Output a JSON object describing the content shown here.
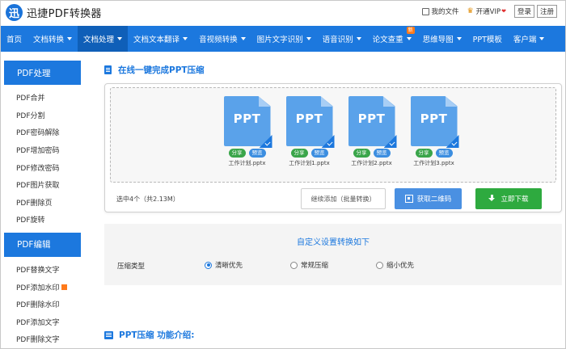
{
  "app": {
    "logo_mark": "迅",
    "logo_text": "迅捷PDF转换器"
  },
  "top_links": {
    "my_files": "我的文件",
    "open_vip": "开通VIP",
    "vip_badge": "❤",
    "login": "登录",
    "register": "注册"
  },
  "nav": [
    {
      "label": "首页",
      "dropdown": false,
      "active": false
    },
    {
      "label": "文档转换",
      "dropdown": true,
      "active": false
    },
    {
      "label": "文档处理",
      "dropdown": true,
      "active": true
    },
    {
      "label": "文档文本翻译",
      "dropdown": true,
      "active": false
    },
    {
      "label": "音视频转换",
      "dropdown": true,
      "active": false
    },
    {
      "label": "图片文字识别",
      "dropdown": true,
      "active": false
    },
    {
      "label": "语音识别",
      "dropdown": true,
      "active": false
    },
    {
      "label": "论文查重",
      "dropdown": true,
      "active": false,
      "badge": "新"
    },
    {
      "label": "思维导图",
      "dropdown": true,
      "active": false
    },
    {
      "label": "PPT模板",
      "dropdown": false,
      "active": false
    },
    {
      "label": "客户端",
      "dropdown": true,
      "active": false
    }
  ],
  "sidebar": {
    "group1_title": "PDF处理",
    "group1_items": [
      "PDF合并",
      "PDF分割",
      "PDF密码解除",
      "PDF增加密码",
      "PDF修改密码",
      "PDF图片获取",
      "PDF删除页",
      "PDF旋转"
    ],
    "group2_title": "PDF编辑",
    "group2_items": [
      "PDF替换文字",
      "PDF添加水印",
      "PDF删除水印",
      "PDF添加文字",
      "PDF删除文字"
    ]
  },
  "main": {
    "section_title": "在线一键完成PPT压缩",
    "files": [
      {
        "name": "工作计划.pptx",
        "icon_text": "PPT",
        "share": "分享",
        "preview": "预览"
      },
      {
        "name": "工作计划1.pptx",
        "icon_text": "PPT",
        "share": "分享",
        "preview": "预览"
      },
      {
        "name": "工作计划2.pptx",
        "icon_text": "PPT",
        "share": "分享",
        "preview": "预览"
      },
      {
        "name": "工作计划3.pptx",
        "icon_text": "PPT",
        "share": "分享",
        "preview": "预览"
      }
    ],
    "selected_info": "选中4个（共2.13M）",
    "btn_add": "继续添加（批量转换）",
    "btn_qr": "获取二维码",
    "btn_download": "立即下载"
  },
  "settings": {
    "title": "自定义设置转换如下",
    "option_label": "压缩类型",
    "options": [
      "清晰优先",
      "常规压缩",
      "缩小优先"
    ],
    "selected": "清晰优先"
  },
  "intro": {
    "title": "PPT压缩 功能介绍:"
  },
  "colors": {
    "brand_blue": "#1c78de",
    "active_nav": "#0f5fb8",
    "download_green": "#2eaa3f",
    "qr_blue": "#4a90e2",
    "new_badge": "#ff7a1a"
  }
}
